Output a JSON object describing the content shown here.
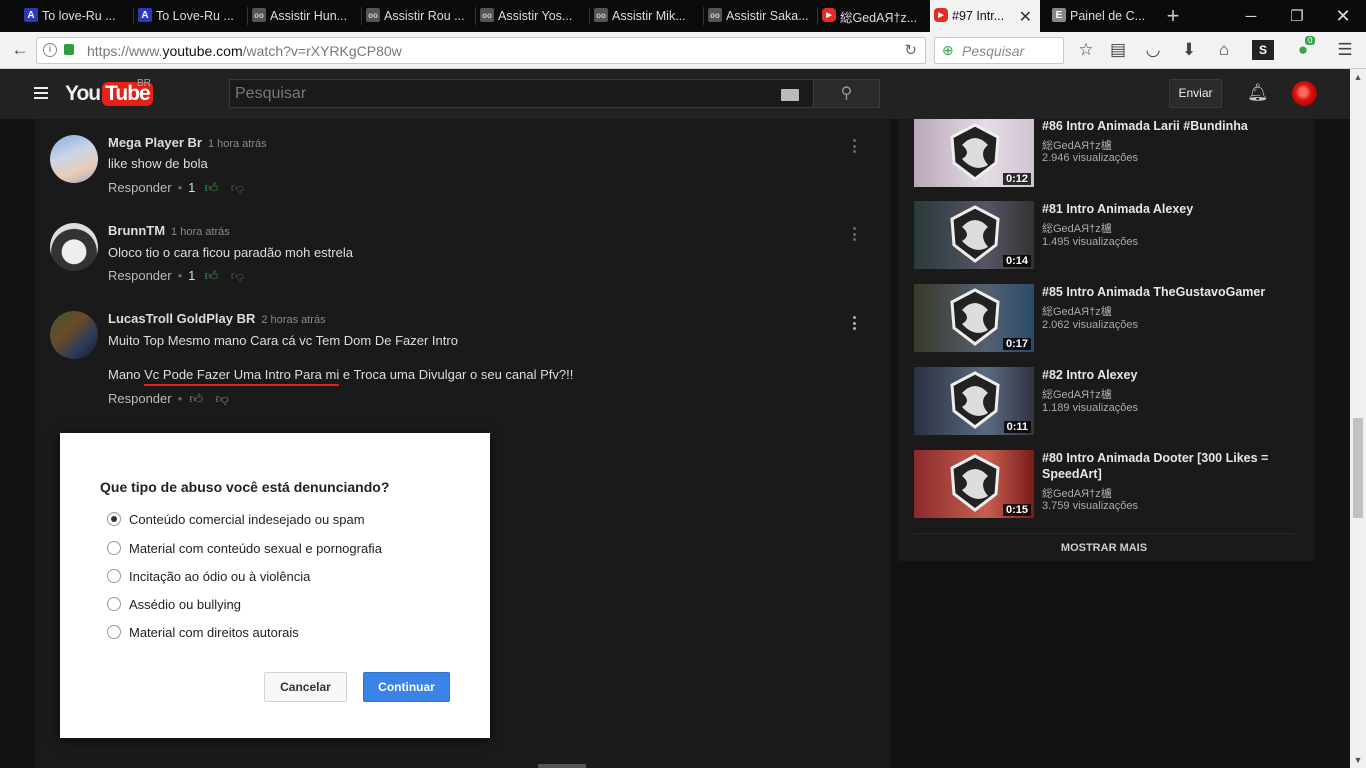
{
  "browser": {
    "tabs": [
      {
        "label": "To love-Ru ...",
        "icon": "A"
      },
      {
        "label": "To Love-Ru ...",
        "icon": "A"
      },
      {
        "label": "Assistir Hun...",
        "icon": "oo"
      },
      {
        "label": "Assistir Rou ...",
        "icon": "oo"
      },
      {
        "label": "Assistir Yos...",
        "icon": "oo"
      },
      {
        "label": "Assistir Mik...",
        "icon": "oo"
      },
      {
        "label": "Assistir Saka...",
        "icon": "oo"
      },
      {
        "label": "総GedAЯ†z...",
        "icon": "yt"
      },
      {
        "label": "#97 Intr...",
        "icon": "yt"
      },
      {
        "label": "Painel de C...",
        "icon": "E"
      }
    ],
    "url_prefix": "https://www.",
    "url_domain": "youtube.com",
    "url_path": "/watch?v=rXYRKgCP80w",
    "search_placeholder": "Pesquisar",
    "badge_count": "0"
  },
  "yt_header": {
    "logo_you": "You",
    "logo_tube": "Tube",
    "region": "BR",
    "search_placeholder": "Pesquisar",
    "upload_label": "Enviar"
  },
  "comments": [
    {
      "author": "Mega Player Br",
      "time": "1 hora atrás",
      "text": "like show de bola",
      "reply": "Responder",
      "likes": "1"
    },
    {
      "author": "BrunnTM",
      "time": "1 hora atrás",
      "text": "Oloco tio o cara ficou paradão moh estrela",
      "reply": "Responder",
      "likes": "1"
    },
    {
      "author": "LucasTroll GoldPlay BR",
      "time": "2 horas atrás",
      "text": "Muito Top Mesmo mano Cara cá vc Tem Dom De Fazer Intro",
      "text2_a": "Mano ",
      "text2_u": "Vc Pode Fazer Uma Intro Para mi",
      "text2_b": " e Troca uma Divulgar o seu canal Pfv?!!",
      "reply": "Responder",
      "likes": ""
    }
  ],
  "dialog": {
    "question": "Que tipo de abuso você está denunciando?",
    "options": [
      "Conteúdo comercial indesejado ou spam",
      "Material com conteúdo sexual e pornografia",
      "Incitação ao ódio ou à violência",
      "Assédio ou bullying",
      "Material com direitos autorais"
    ],
    "selected_index": 0,
    "cancel": "Cancelar",
    "continue": "Continuar"
  },
  "sidebar": {
    "videos": [
      {
        "title": "#86 Intro Animada Larii #Bundinha",
        "channel": "総GedAЯ†z櫨",
        "views": "2.946 visualizações",
        "duration": "0:12"
      },
      {
        "title": "#81 Intro Animada Alexey",
        "channel": "総GedAЯ†z櫨",
        "views": "1.495 visualizações",
        "duration": "0:14"
      },
      {
        "title": "#85 Intro Animada TheGustavoGamer",
        "channel": "総GedAЯ†z櫨",
        "views": "2.062 visualizações",
        "duration": "0:17"
      },
      {
        "title": "#82 Intro Alexey",
        "channel": "総GedAЯ†z櫨",
        "views": "1.189 visualizações",
        "duration": "0:11"
      },
      {
        "title": "#80 Intro Animada Dooter [300 Likes = SpeedArt]",
        "channel": "総GedAЯ†z櫨",
        "views": "3.759 visualizações",
        "duration": "0:15"
      }
    ],
    "show_more": "MOSTRAR MAIS"
  },
  "colors": {
    "accent_red": "#e62117",
    "like_green": "#3aa64a",
    "continue_blue": "#3b84e6"
  }
}
